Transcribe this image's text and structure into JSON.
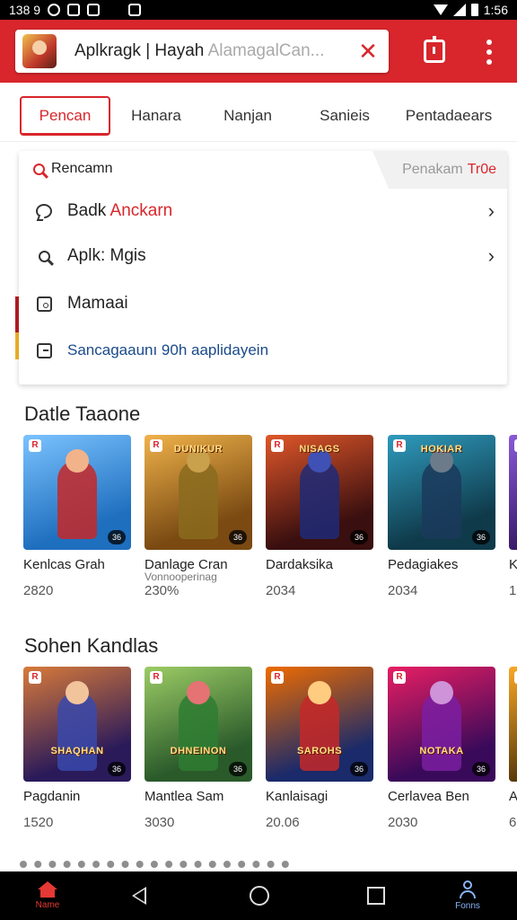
{
  "status_bar": {
    "left_text": "138 9",
    "time": "1:56"
  },
  "app_bar": {
    "search_main": "Aplkragk",
    "search_sep": " | Hayah ",
    "search_faded": "AlamagalCan...",
    "close_symbol": "✕"
  },
  "tabs": [
    "Pencan",
    "Hanara",
    "Nanjan",
    "Sanieis",
    "Pentadaears"
  ],
  "dropdown": {
    "query": "Rencamn",
    "hint_text": "Penakam",
    "hint_accent": "Tr0e",
    "items": [
      {
        "label_a": "Badk ",
        "label_b": "Anckarn",
        "icon": "chat-bubble-icon",
        "chevron": "›"
      },
      {
        "label_a": "Aplk: Mgis",
        "label_b": "",
        "icon": "search-icon",
        "chevron": "›"
      },
      {
        "label_a": "Mamaai",
        "label_b": "",
        "icon": "image-icon",
        "chevron": ""
      },
      {
        "label_a": "Sancagaaunı 90h aaplidayein",
        "label_b": "",
        "icon": "window-icon",
        "chevron": ""
      }
    ]
  },
  "sections": [
    {
      "title": "Datle Taaone",
      "cards": [
        {
          "name": "Kenlcas Grah",
          "sub": "",
          "year": "2820",
          "banner": "",
          "colors": [
            "#1f6fbf",
            "#7bc3ff",
            "#c62828",
            "#f2b38a"
          ]
        },
        {
          "name": "Danlage Cran",
          "sub": "Vonnooperinag",
          "year": "230%",
          "banner": "DUNIKUR",
          "colors": [
            "#7a4a12",
            "#f0b24a",
            "#8a6b1f",
            "#c9a04b"
          ]
        },
        {
          "name": "Dardaksika",
          "sub": "",
          "year": "2034",
          "banner": "NISAGS",
          "colors": [
            "#3a0f0f",
            "#e0572a",
            "#1e2a78",
            "#3f51b5"
          ]
        },
        {
          "name": "Pedagiakes",
          "sub": "",
          "year": "2034",
          "banner": "HOKIAR",
          "colors": [
            "#0f3a4a",
            "#2f9bbd",
            "#1b3a5c",
            "#6c7b8a"
          ]
        },
        {
          "name": "K",
          "sub": "",
          "year": "1",
          "banner": "",
          "colors": [
            "#3a1a6a",
            "#8a5ad8",
            "#5e35b1",
            "#b39ddb"
          ]
        }
      ]
    },
    {
      "title": "Sohen Kandlas",
      "cards": [
        {
          "name": "Pagdanin",
          "sub": "",
          "year": "1520",
          "banner": "SHAQHAN",
          "colors": [
            "#2a1a5a",
            "#d87a3a",
            "#3949ab",
            "#f2c49b"
          ]
        },
        {
          "name": "Mantlea Sam",
          "sub": "",
          "year": "3030",
          "banner": "DHNEINON",
          "colors": [
            "#2a5a2a",
            "#9ccc65",
            "#2e7d32",
            "#e57373"
          ]
        },
        {
          "name": "Kanlaisagi",
          "sub": "",
          "year": "20.06",
          "banner": "SAROHS",
          "colors": [
            "#1a2a6a",
            "#ef6c00",
            "#c62828",
            "#ffcc80"
          ]
        },
        {
          "name": "Cerlavea Ben",
          "sub": "",
          "year": "2030",
          "banner": "NOTAKA",
          "colors": [
            "#3a0a5a",
            "#e91e63",
            "#7b1fa2",
            "#ce93d8"
          ]
        },
        {
          "name": "A",
          "sub": "",
          "year": "6",
          "banner": "",
          "colors": [
            "#5a3a0a",
            "#f9a825",
            "#8d6e63",
            "#ffe082"
          ]
        }
      ]
    }
  ],
  "card_badge": "36",
  "card_corner": "R",
  "bottom_nav": {
    "home_label": "Name",
    "profile_label": "Fonns"
  },
  "colors": {
    "accent": "#d8262c",
    "app_bar": "#d8262c",
    "nav_bg": "#000000",
    "profile_icon": "#8ab4f8"
  }
}
